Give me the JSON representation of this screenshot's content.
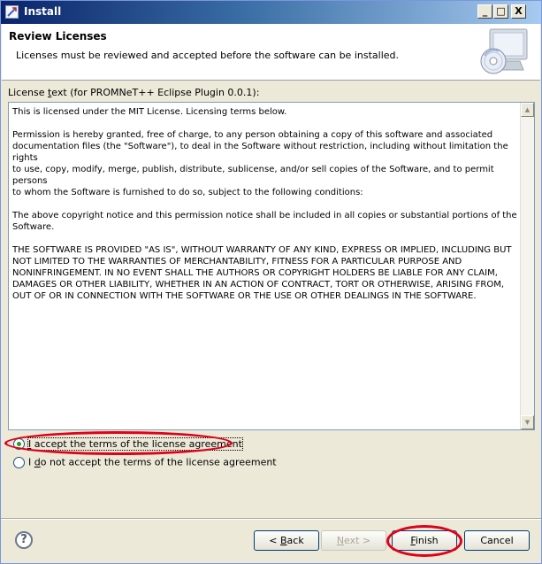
{
  "window": {
    "title": "Install",
    "controls": {
      "minimize": "_",
      "maximize": "□",
      "close": "X"
    }
  },
  "banner": {
    "title": "Review Licenses",
    "description": "Licenses must be reviewed and accepted before the software can be installed.",
    "graphic_icon": "computer-cd-icon"
  },
  "license": {
    "label_prefix": "License ",
    "label_accel": "t",
    "label_suffix": "ext (for PROMNeT++ Eclipse Plugin 0.0.1):",
    "text": "This is licensed under the MIT License. Licensing terms below.\n\nPermission is hereby granted, free of charge, to any person obtaining a copy of this software and associated\ndocumentation files (the \"Software\"), to deal in the Software without restriction, including without limitation the rights\nto use, copy, modify, merge, publish, distribute, sublicense, and/or sell copies of the Software, and to permit persons\nto whom the Software is furnished to do so, subject to the following conditions:\n\nThe above copyright notice and this permission notice shall be included in all copies or substantial portions of the\nSoftware.\n\nTHE SOFTWARE IS PROVIDED \"AS IS\", WITHOUT WARRANTY OF ANY KIND, EXPRESS OR IMPLIED, INCLUDING BUT\nNOT LIMITED TO THE WARRANTIES OF MERCHANTABILITY, FITNESS FOR A PARTICULAR PURPOSE AND\nNONINFRINGEMENT. IN NO EVENT SHALL THE AUTHORS OR COPYRIGHT HOLDERS BE LIABLE FOR ANY CLAIM,\nDAMAGES OR OTHER LIABILITY, WHETHER IN AN ACTION OF CONTRACT, TORT OR OTHERWISE, ARISING FROM,\nOUT OF OR IN CONNECTION WITH THE SOFTWARE OR THE USE OR OTHER DEALINGS IN THE SOFTWARE."
  },
  "options": {
    "accept": {
      "accel": "I",
      "rest": " accept the terms of the license agreement",
      "selected": true
    },
    "decline": {
      "pre": "I ",
      "accel": "d",
      "rest": "o not accept the terms of the license agreement",
      "selected": false
    }
  },
  "buttons": {
    "help_glyph": "?",
    "back": {
      "pre": "< ",
      "accel": "B",
      "rest": "ack",
      "enabled": true
    },
    "next": {
      "pre": "",
      "accel": "N",
      "rest": "ext >",
      "enabled": false
    },
    "finish": {
      "pre": "",
      "accel": "F",
      "rest": "inish",
      "enabled": true
    },
    "cancel": {
      "label": "Cancel",
      "enabled": true
    }
  },
  "annotations": {
    "highlight_color": "#e0001a"
  }
}
